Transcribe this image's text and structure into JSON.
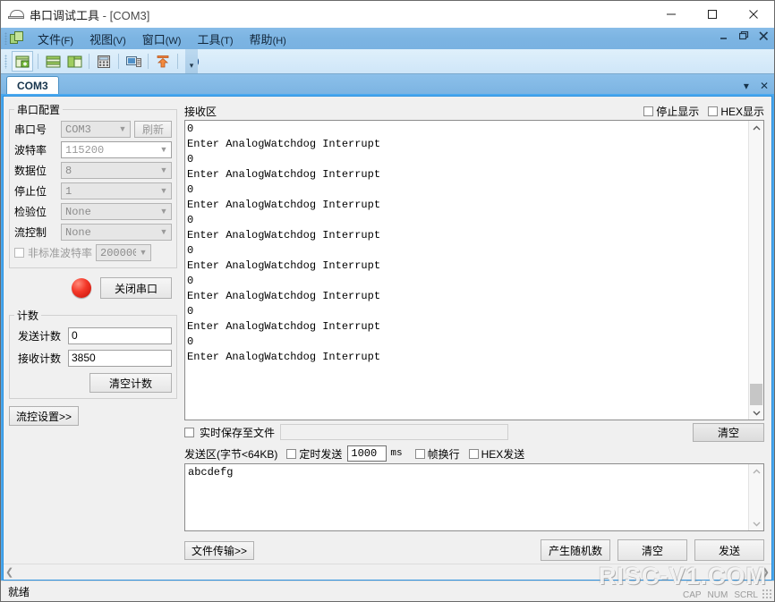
{
  "window": {
    "title_main": "串口调试工具",
    "title_doc": "- [COM3]",
    "minimize": "—",
    "maximize": "▢",
    "close": "✕"
  },
  "menubar": {
    "items": [
      {
        "label": "文件",
        "mnemonic": "(F)"
      },
      {
        "label": "视图",
        "mnemonic": "(V)"
      },
      {
        "label": "窗口",
        "mnemonic": "(W)"
      },
      {
        "label": "工具",
        "mnemonic": "(T)"
      },
      {
        "label": "帮助",
        "mnemonic": "(H)"
      }
    ],
    "mdi_minimize": "–",
    "mdi_restore": "❐",
    "mdi_close": "✕"
  },
  "toolbar": {
    "overflow": "▾",
    "buttons": [
      {
        "name": "new-window-icon"
      },
      {
        "name": "tile-horizontal-icon"
      },
      {
        "name": "tile-vertical-icon"
      },
      {
        "name": "calculator-icon"
      },
      {
        "name": "monitor-icon"
      },
      {
        "name": "upload-icon"
      },
      {
        "name": "help-icon"
      }
    ]
  },
  "tabs": {
    "active": "COM3",
    "dropdown": "▾",
    "close": "✕"
  },
  "config": {
    "legend": "串口配置",
    "port_label": "串口号",
    "port_value": "COM3",
    "refresh_label": "刷新",
    "baud_label": "波特率",
    "baud_value": "115200",
    "databits_label": "数据位",
    "databits_value": "8",
    "stopbits_label": "停止位",
    "stopbits_value": "1",
    "parity_label": "检验位",
    "parity_value": "None",
    "flow_label": "流控制",
    "flow_value": "None",
    "nonstandard_label": "非标准波特率",
    "nonstandard_value": "200000",
    "close_port_label": "关闭串口"
  },
  "counters": {
    "legend": "计数",
    "send_label": "发送计数",
    "send_value": "0",
    "recv_label": "接收计数",
    "recv_value": "3850",
    "clear_label": "清空计数"
  },
  "flow_settings_label": "流控设置>>",
  "receive": {
    "title": "接收区",
    "stop_display_label": "停止显示",
    "hex_display_label": "HEX显示",
    "content": "0\nEnter AnalogWatchdog Interrupt\n0\nEnter AnalogWatchdog Interrupt\n0\nEnter AnalogWatchdog Interrupt\n0\nEnter AnalogWatchdog Interrupt\n0\nEnter AnalogWatchdog Interrupt\n0\nEnter AnalogWatchdog Interrupt\n0\nEnter AnalogWatchdog Interrupt\n0\nEnter AnalogWatchdog Interrupt",
    "scroll_up": "︿",
    "scroll_down": "﹀"
  },
  "save_row": {
    "realtime_save_label": "实时保存至文件",
    "path_value": "",
    "clear_label": "清空"
  },
  "send": {
    "title": "发送区(字节<64KB)",
    "timed_send_label": "定时发送",
    "interval_value": "1000",
    "interval_unit": "ms",
    "frame_newline_label": "帧换行",
    "hex_send_label": "HEX发送",
    "content": "abcdefg",
    "scroll_up": "︿",
    "scroll_down": "﹀"
  },
  "bottom": {
    "file_transfer_label": "文件传输>>",
    "random_label": "产生随机数",
    "clear_label": "清空",
    "send_label": "发送"
  },
  "hscroll": {
    "left": "❮",
    "right": "❯"
  },
  "statusbar": {
    "text": "就绪",
    "cap": "CAP",
    "num": "NUM",
    "scrl": "SCRL"
  },
  "watermark": "RISC-V1.COM"
}
